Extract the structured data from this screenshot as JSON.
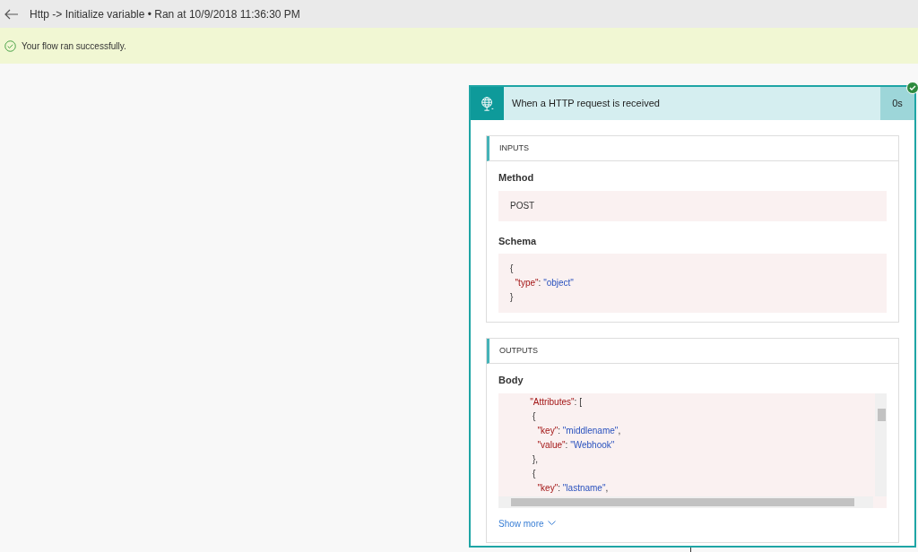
{
  "header": {
    "title": "Http -> Initialize variable • Ran at 10/9/2018 11:36:30 PM"
  },
  "banner": {
    "message": "Your flow ran successfully.",
    "succeeded": true
  },
  "card": {
    "title": "When a HTTP request is received",
    "duration": "0s",
    "succeeded": true,
    "inputs": {
      "heading": "INPUTS",
      "fields": [
        {
          "label": "Method",
          "lines": [
            [
              {
                "kind": "plain",
                "text": "POST"
              }
            ]
          ]
        },
        {
          "label": "Schema",
          "lines": [
            [
              {
                "kind": "punct",
                "text": "{"
              }
            ],
            [
              {
                "kind": "key",
                "text": "  \"type\""
              },
              {
                "kind": "punct",
                "text": ": "
              },
              {
                "kind": "string",
                "text": "\"object\""
              }
            ],
            [
              {
                "kind": "punct",
                "text": "}"
              }
            ]
          ]
        }
      ]
    },
    "outputs": {
      "heading": "OUTPUTS",
      "fields": [
        {
          "label": "Body",
          "scroll": true,
          "lines": [
            [
              {
                "kind": "key",
                "text": "        \"Attributes\""
              },
              {
                "kind": "punct",
                "text": ": ["
              }
            ],
            [
              {
                "kind": "punct",
                "text": "         {"
              }
            ],
            [
              {
                "kind": "key",
                "text": "           \"key\""
              },
              {
                "kind": "punct",
                "text": ": "
              },
              {
                "kind": "string",
                "text": "\"middlename\""
              },
              {
                "kind": "punct",
                "text": ","
              }
            ],
            [
              {
                "kind": "key",
                "text": "           \"value\""
              },
              {
                "kind": "punct",
                "text": ": "
              },
              {
                "kind": "string",
                "text": "\"Webhook\""
              }
            ],
            [
              {
                "kind": "punct",
                "text": "         },"
              }
            ],
            [
              {
                "kind": "punct",
                "text": "         {"
              }
            ],
            [
              {
                "kind": "key",
                "text": "           \"key\""
              },
              {
                "kind": "punct",
                "text": ": "
              },
              {
                "kind": "string",
                "text": "\"lastname\""
              },
              {
                "kind": "punct",
                "text": ","
              }
            ]
          ]
        }
      ],
      "show_more": "Show more"
    }
  }
}
